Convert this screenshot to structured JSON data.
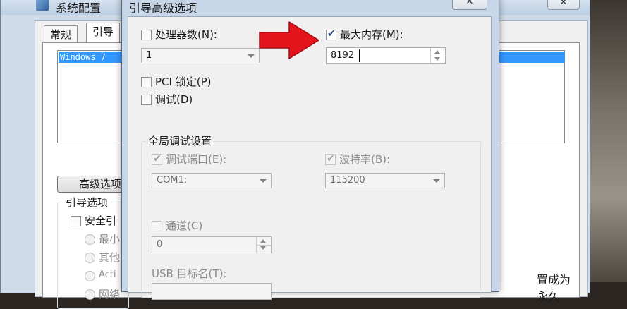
{
  "back_window": {
    "title": "系统配置",
    "tabs": [
      "常规",
      "引导"
    ],
    "os_entry": "Windows 7",
    "advanced_button": "高级选项",
    "boot_options_label": "引导选项",
    "safe_boot": "安全引",
    "radios": [
      "最小",
      "其他",
      "Acti",
      "网络"
    ],
    "right_text": "置成为永久"
  },
  "dialog": {
    "title": "引导高级选项",
    "num_processors": {
      "label": "处理器数(N):",
      "checked": false,
      "value": "1"
    },
    "max_memory": {
      "label": "最大内存(M):",
      "checked": true,
      "value": "8192"
    },
    "pci_lock": {
      "label": "PCI 锁定(P)",
      "checked": false
    },
    "debug": {
      "label": "调试(D)",
      "checked": false
    },
    "global_debug": {
      "title": "全局调试设置",
      "debug_port": {
        "label": "调试端口(E):",
        "checked": true,
        "value": "COM1:"
      },
      "baud_rate": {
        "label": "波特率(B):",
        "checked": true,
        "value": "115200"
      },
      "channel": {
        "label": "通道(C)",
        "checked": false,
        "value": "0"
      },
      "usb_target": {
        "label": "USB 目标名(T):"
      }
    }
  },
  "colors": {
    "arrow": "#e3141b",
    "selection": "#3399ff"
  }
}
